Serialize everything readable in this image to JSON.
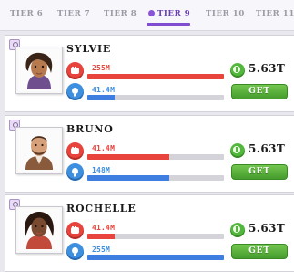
{
  "tabs": [
    {
      "label": "TIER 6"
    },
    {
      "label": "TIER 7"
    },
    {
      "label": "TIER 8"
    },
    {
      "label": "TIER 9",
      "active": true
    },
    {
      "label": "TIER 10"
    },
    {
      "label": "TIER 11"
    }
  ],
  "colors": {
    "accent_purple": "#7f4ed0",
    "stat_red": "#e8443d",
    "stat_blue": "#3d8fe0",
    "button_green": "#52b83c"
  },
  "characters": [
    {
      "name": "SYLVIE",
      "stat1_value": "255M",
      "stat1_fill": 1.0,
      "stat2_value": "41.4M",
      "stat2_fill": 0.2,
      "cost": "5.63T",
      "button_label": "GET"
    },
    {
      "name": "BRUNO",
      "stat1_value": "41.4M",
      "stat1_fill": 0.6,
      "stat2_value": "148M",
      "stat2_fill": 0.6,
      "cost": "5.63T",
      "button_label": "GET"
    },
    {
      "name": "ROCHELLE",
      "stat1_value": "41.4M",
      "stat1_fill": 0.2,
      "stat2_value": "255M",
      "stat2_fill": 1.0,
      "cost": "5.63T",
      "button_label": "GET"
    }
  ],
  "icons": {
    "tab_active_dot": "tier-dot-icon",
    "card_badge": "lock-badge-icon",
    "stat1": "fist-icon",
    "stat2": "lightbulb-icon",
    "cost": "cash-icon"
  }
}
